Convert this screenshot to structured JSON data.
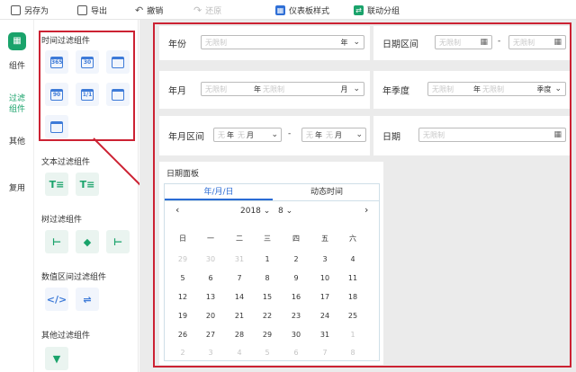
{
  "toolbar": {
    "save_as": "另存为",
    "export": "导出",
    "undo": "撤销",
    "redo": "还原",
    "dashboard_style": "仪表板样式",
    "linkage_group": "联动分组"
  },
  "left_tabs": {
    "components": "组件",
    "filter_line1": "过滤",
    "filter_line2": "组件",
    "other": "其他",
    "reuse": "复用"
  },
  "panel": {
    "time_filter": "时间过滤组件",
    "time_icons": [
      "365",
      "30",
      "",
      "90",
      "1/1",
      "",
      ""
    ],
    "text_filter": "文本过滤组件",
    "tree_filter": "树过滤组件",
    "numeric_filter": "数值区间过滤组件",
    "other_filter": "其他过滤组件"
  },
  "canvas": {
    "year": {
      "label": "年份",
      "placeholder": "无限制",
      "unit": "年"
    },
    "date_range": {
      "label": "日期区间",
      "placeholder_start": "无限制",
      "dash": "-",
      "placeholder_end": "无限制"
    },
    "year_month": {
      "label": "年月",
      "placeholder_year": "无限制",
      "unit_year": "年",
      "placeholder_month": "无限制",
      "unit_month": "月"
    },
    "year_quarter": {
      "label": "年季度",
      "placeholder_year": "无限制",
      "unit_year": "年",
      "placeholder_quarter": "无限制",
      "unit_quarter": "季度"
    },
    "year_month_range": {
      "label": "年月区间",
      "ph_a": "无",
      "unit_y": "年",
      "ph_b": "无",
      "unit_m": "月",
      "dash": "-"
    },
    "date": {
      "label": "日期",
      "placeholder": "无限制"
    },
    "date_panel": {
      "title": "日期面板",
      "tab_ymd": "年/月/日",
      "tab_dynamic": "动态时间",
      "year_sel": "2018",
      "month_sel": "8",
      "weekdays": [
        "日",
        "一",
        "二",
        "三",
        "四",
        "五",
        "六"
      ],
      "days": [
        [
          "29",
          "30",
          "31",
          "1",
          "2",
          "3",
          "4"
        ],
        [
          "5",
          "6",
          "7",
          "8",
          "9",
          "10",
          "11"
        ],
        [
          "12",
          "13",
          "14",
          "15",
          "16",
          "17",
          "18"
        ],
        [
          "19",
          "20",
          "21",
          "22",
          "23",
          "24",
          "25"
        ],
        [
          "26",
          "27",
          "28",
          "29",
          "30",
          "31",
          "1"
        ],
        [
          "2",
          "3",
          "4",
          "5",
          "6",
          "7",
          "8"
        ]
      ]
    }
  },
  "colors": {
    "accent_green": "#1aa36b",
    "accent_blue": "#2a6bd4",
    "highlight_red": "#cc2233"
  }
}
